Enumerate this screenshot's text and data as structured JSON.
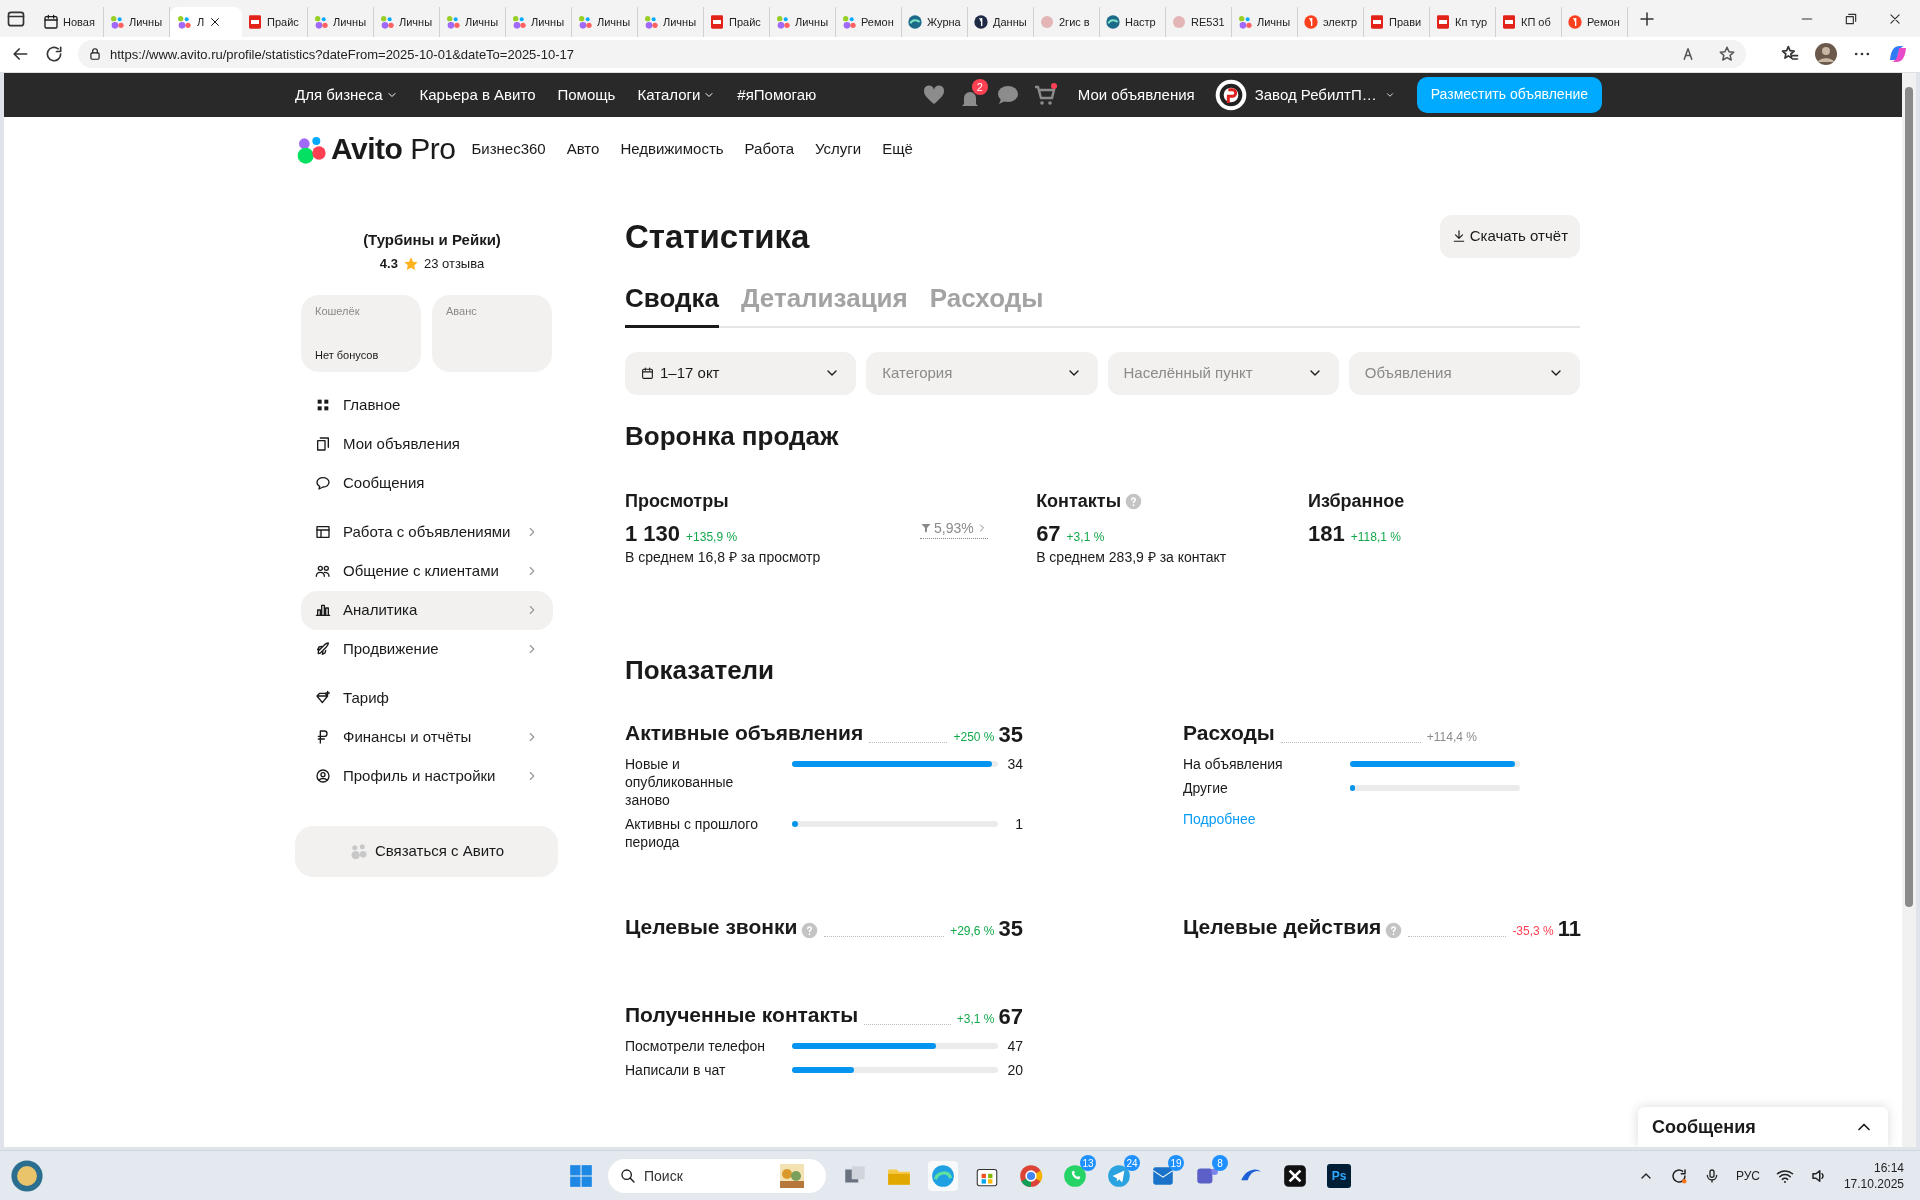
{
  "browser": {
    "tabs": [
      {
        "title": "Новая",
        "selected": false
      },
      {
        "title": "Личны",
        "selected": false
      },
      {
        "title": "Л",
        "selected": true
      },
      {
        "title": "Прайс",
        "selected": false
      },
      {
        "title": "Личны",
        "selected": false
      },
      {
        "title": "Личны",
        "selected": false
      },
      {
        "title": "Личны",
        "selected": false
      },
      {
        "title": "Личны",
        "selected": false
      },
      {
        "title": "Личны",
        "selected": false
      },
      {
        "title": "Личны",
        "selected": false
      },
      {
        "title": "Прайс",
        "selected": false
      },
      {
        "title": "Личны",
        "selected": false
      },
      {
        "title": "Ремон",
        "selected": false
      },
      {
        "title": "Журна",
        "selected": false
      },
      {
        "title": "Данны",
        "selected": false
      },
      {
        "title": "2гис в",
        "selected": false
      },
      {
        "title": "Настр",
        "selected": false
      },
      {
        "title": "RE531",
        "selected": false
      },
      {
        "title": "Личны",
        "selected": false
      },
      {
        "title": "электр",
        "selected": false
      },
      {
        "title": "Прави",
        "selected": false
      },
      {
        "title": "Кп тур",
        "selected": false
      },
      {
        "title": "КП об",
        "selected": false
      },
      {
        "title": "Ремон",
        "selected": false
      }
    ],
    "address": "https://www.avito.ru/profile/statistics?dateFrom=2025-10-01&dateTo=2025-10-17"
  },
  "header": {
    "links": [
      {
        "label": "Для бизнеса",
        "dropdown": true
      },
      {
        "label": "Карьера в Авито",
        "dropdown": false
      },
      {
        "label": "Помощь",
        "dropdown": false
      },
      {
        "label": "Каталоги",
        "dropdown": true
      },
      {
        "label": "#яПомогаю",
        "dropdown": false
      }
    ],
    "notifications_badge": "2",
    "my_ads": "Мои объявления",
    "account": "Завод РебилтП…",
    "post_button": "Разместить объявление"
  },
  "logo": {
    "name": "Avito",
    "suffix": "Pro"
  },
  "subnav": [
    "Бизнес360",
    "Авто",
    "Недвижимость",
    "Работа",
    "Услуги",
    "Ещё"
  ],
  "sidebar": {
    "company": "(Турбины и Рейки)",
    "rating": "4.3",
    "reviews": "23 отзыва",
    "wallets": [
      {
        "label": "Кошелёк",
        "value": "Нет бонусов"
      },
      {
        "label": "Аванс"
      }
    ],
    "groups": [
      [
        {
          "label": "Главное",
          "selected": false,
          "submenu": false
        },
        {
          "label": "Мои объявления",
          "selected": false,
          "submenu": false
        },
        {
          "label": "Сообщения",
          "selected": false,
          "submenu": false
        }
      ],
      [
        {
          "label": "Работа с объявлениями",
          "selected": false,
          "submenu": true
        },
        {
          "label": "Общение с клиентами",
          "selected": false,
          "submenu": true
        },
        {
          "label": "Аналитика",
          "selected": true,
          "submenu": true
        },
        {
          "label": "Продвижение",
          "selected": false,
          "submenu": true
        }
      ],
      [
        {
          "label": "Тариф",
          "selected": false,
          "submenu": false
        },
        {
          "label": "Финансы и отчёты",
          "selected": false,
          "submenu": true
        },
        {
          "label": "Профиль и настройки",
          "selected": false,
          "submenu": true
        }
      ]
    ],
    "contact_button": "Связаться с Авито"
  },
  "main": {
    "title": "Статистика",
    "download_button": "Скачать отчёт",
    "tabs": [
      {
        "label": "Сводка",
        "selected": true
      },
      {
        "label": "Детализация",
        "selected": false
      },
      {
        "label": "Расходы",
        "selected": false
      }
    ],
    "filters": [
      {
        "kind": "date",
        "value": "1–17 окт"
      },
      {
        "kind": "select",
        "placeholder": "Категория"
      },
      {
        "kind": "select",
        "placeholder": "Населённый пункт"
      },
      {
        "kind": "select",
        "placeholder": "Объявления"
      }
    ],
    "funnel": {
      "title": "Воронка продаж",
      "conversion": "5,93%",
      "items": [
        {
          "title": "Просмотры",
          "help": false,
          "value": "1 130",
          "change": "+135,9 %",
          "color": "#12a84a",
          "note": "В среднем 16,8 ₽ за просмотр"
        },
        {
          "title": "Контакты",
          "help": true,
          "value": "67",
          "change": "+3,1 %",
          "color": "#12a84a",
          "note": "В среднем 283,9 ₽ за контакт"
        },
        {
          "title": "Избранное",
          "help": false,
          "value": "181",
          "change": "+118,1 %",
          "color": "#12a84a"
        }
      ]
    },
    "indicators": {
      "title": "Показатели",
      "metrics": [
        {
          "title": "Активные объявления",
          "help": false,
          "change": "+250 %",
          "color": "#12a84a",
          "value": "35",
          "bars": [
            {
              "label": "Новые и опубликованные заново",
              "level": 0.97,
              "value": "34"
            },
            {
              "label": "Активны с прошлого периода",
              "level": 0.03,
              "value": "1"
            }
          ]
        },
        {
          "title": "Расходы",
          "help": false,
          "change": "+114,4 %",
          "color": "#8a8a8a",
          "bars": [
            {
              "label": "На объявления",
              "level": 0.97
            },
            {
              "label": "Другие",
              "level": 0.03
            }
          ],
          "link": "Подробнее"
        },
        {
          "title": "Целевые звонки",
          "help": true,
          "change": "+29,6 %",
          "color": "#12a84a",
          "value": "35"
        },
        {
          "title": "Целевые действия",
          "help": true,
          "change": "-35,3 %",
          "color": "#ff4053",
          "value": "11"
        },
        {
          "title": "Полученные контакты",
          "help": false,
          "change": "+3,1 %",
          "color": "#12a84a",
          "value": "67",
          "bars": [
            {
              "label": "Посмотрели телефон",
              "level": 0.7,
              "value": "47"
            },
            {
              "label": "Написали в чат",
              "level": 0.3,
              "value": "20"
            }
          ]
        }
      ]
    }
  },
  "chat_panel": {
    "title": "Сообщения"
  },
  "taskbar": {
    "search_placeholder": "Поиск",
    "badges": [
      "13",
      "24",
      "19",
      "8"
    ],
    "ps_label": "Ps",
    "language": "РУС",
    "time": "16:14",
    "date": "17.10.2025"
  }
}
